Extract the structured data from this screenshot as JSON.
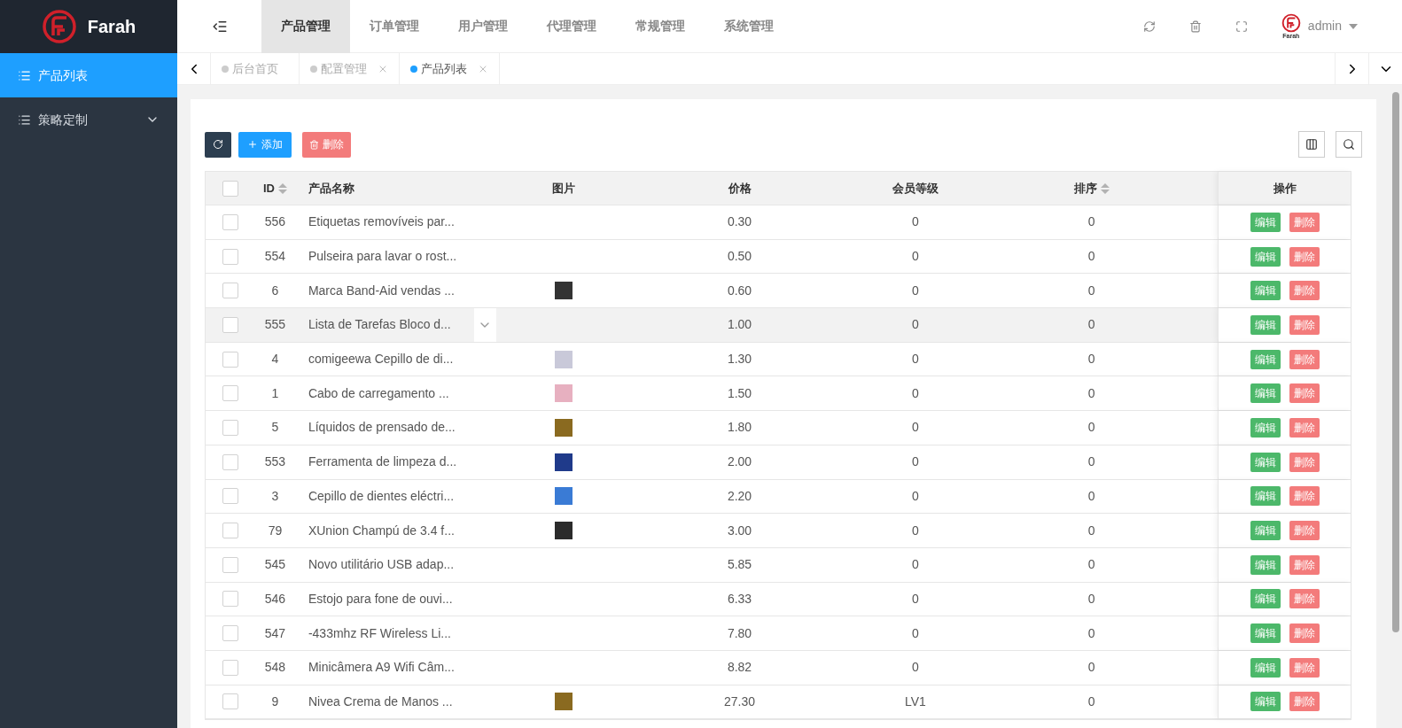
{
  "brand": {
    "name": "Farah",
    "logo_caption": "Farah"
  },
  "sidebar": {
    "items": [
      {
        "label": "产品列表",
        "selected": true,
        "expandable": false
      },
      {
        "label": "策略定制",
        "selected": false,
        "expandable": true
      }
    ]
  },
  "top_nav": {
    "items": [
      {
        "label": "产品管理",
        "selected": true
      },
      {
        "label": "订单管理",
        "selected": false
      },
      {
        "label": "用户管理",
        "selected": false
      },
      {
        "label": "代理管理",
        "selected": false
      },
      {
        "label": "常规管理",
        "selected": false
      },
      {
        "label": "系统管理",
        "selected": false
      }
    ]
  },
  "user": {
    "name": "admin"
  },
  "page_tabs": [
    {
      "label": "后台首页",
      "selected": false,
      "closable": false
    },
    {
      "label": "配置管理",
      "selected": false,
      "closable": true
    },
    {
      "label": "产品列表",
      "selected": true,
      "closable": true
    }
  ],
  "toolbar": {
    "add": "添加",
    "delete": "删除"
  },
  "table": {
    "header_checked": false,
    "columns": [
      {
        "label": "ID",
        "sortable": true
      },
      {
        "label": "产品名称",
        "sortable": false
      },
      {
        "label": "图片",
        "sortable": false
      },
      {
        "label": "价格",
        "sortable": false
      },
      {
        "label": "会员等级",
        "sortable": false
      },
      {
        "label": "排序",
        "sortable": true
      },
      {
        "label": "操作",
        "sortable": false
      }
    ],
    "rows": [
      {
        "id": "556",
        "name": "Etiquetas removíveis par...",
        "photo": false,
        "price": "0.30",
        "member_tier": "0",
        "sort": "0",
        "checked": false,
        "highlighted": false,
        "actions": [
          "编辑",
          "删除"
        ]
      },
      {
        "id": "554",
        "name": "Pulseira para lavar o rost...",
        "photo": false,
        "price": "0.50",
        "member_tier": "0",
        "sort": "0",
        "checked": false,
        "highlighted": false,
        "actions": [
          "编辑",
          "删除"
        ]
      },
      {
        "id": "6",
        "name": "Marca Band-Aid vendas ...",
        "photo": true,
        "price": "0.60",
        "member_tier": "0",
        "sort": "0",
        "checked": false,
        "highlighted": false,
        "actions": [
          "编辑",
          "删除"
        ]
      },
      {
        "id": "555",
        "name": "Lista de Tarefas Bloco d...",
        "photo": false,
        "price": "1.00",
        "member_tier": "0",
        "sort": "0",
        "checked": false,
        "highlighted": true,
        "actions": [
          "编辑",
          "删除"
        ]
      },
      {
        "id": "4",
        "name": "comigeewa Cepillo de di...",
        "photo": true,
        "price": "1.30",
        "member_tier": "0",
        "sort": "0",
        "checked": false,
        "highlighted": false,
        "actions": [
          "编辑",
          "删除"
        ]
      },
      {
        "id": "1",
        "name": "Cabo de carregamento ...",
        "photo": true,
        "price": "1.50",
        "member_tier": "0",
        "sort": "0",
        "checked": false,
        "highlighted": false,
        "actions": [
          "编辑",
          "删除"
        ]
      },
      {
        "id": "5",
        "name": "Líquidos de prensado de...",
        "photo": true,
        "price": "1.80",
        "member_tier": "0",
        "sort": "0",
        "checked": false,
        "highlighted": false,
        "actions": [
          "编辑",
          "删除"
        ]
      },
      {
        "id": "553",
        "name": "Ferramenta de limpeza d...",
        "photo": true,
        "price": "2.00",
        "member_tier": "0",
        "sort": "0",
        "checked": false,
        "highlighted": false,
        "actions": [
          "编辑",
          "删除"
        ]
      },
      {
        "id": "3",
        "name": "Cepillo de dientes eléctri...",
        "photo": true,
        "price": "2.20",
        "member_tier": "0",
        "sort": "0",
        "checked": false,
        "highlighted": false,
        "actions": [
          "编辑",
          "删除"
        ]
      },
      {
        "id": "79",
        "name": "XUnion Champú de 3.4 f...",
        "photo": true,
        "price": "3.00",
        "member_tier": "0",
        "sort": "0",
        "checked": false,
        "highlighted": false,
        "actions": [
          "编辑",
          "删除"
        ]
      },
      {
        "id": "545",
        "name": "Novo utilitário USB adap...",
        "photo": false,
        "price": "5.85",
        "member_tier": "0",
        "sort": "0",
        "checked": false,
        "highlighted": false,
        "actions": [
          "编辑",
          "删除"
        ]
      },
      {
        "id": "546",
        "name": "Estojo para fone de ouvi...",
        "photo": false,
        "price": "6.33",
        "member_tier": "0",
        "sort": "0",
        "checked": false,
        "highlighted": false,
        "actions": [
          "编辑",
          "删除"
        ]
      },
      {
        "id": "547",
        "name": "-433mhz RF Wireless Li...",
        "photo": false,
        "price": "7.80",
        "member_tier": "0",
        "sort": "0",
        "checked": false,
        "highlighted": false,
        "actions": [
          "编辑",
          "删除"
        ]
      },
      {
        "id": "548",
        "name": "Minicâmera A9 Wifi Câm...",
        "photo": false,
        "price": "8.82",
        "member_tier": "0",
        "sort": "0",
        "checked": false,
        "highlighted": false,
        "actions": [
          "编辑",
          "删除"
        ]
      },
      {
        "id": "9",
        "name": "Nivea Crema de Manos ...",
        "photo": true,
        "price": "27.30",
        "member_tier": "LV1",
        "sort": "0",
        "checked": false,
        "highlighted": false,
        "actions": [
          "编辑",
          "删除"
        ]
      }
    ]
  }
}
